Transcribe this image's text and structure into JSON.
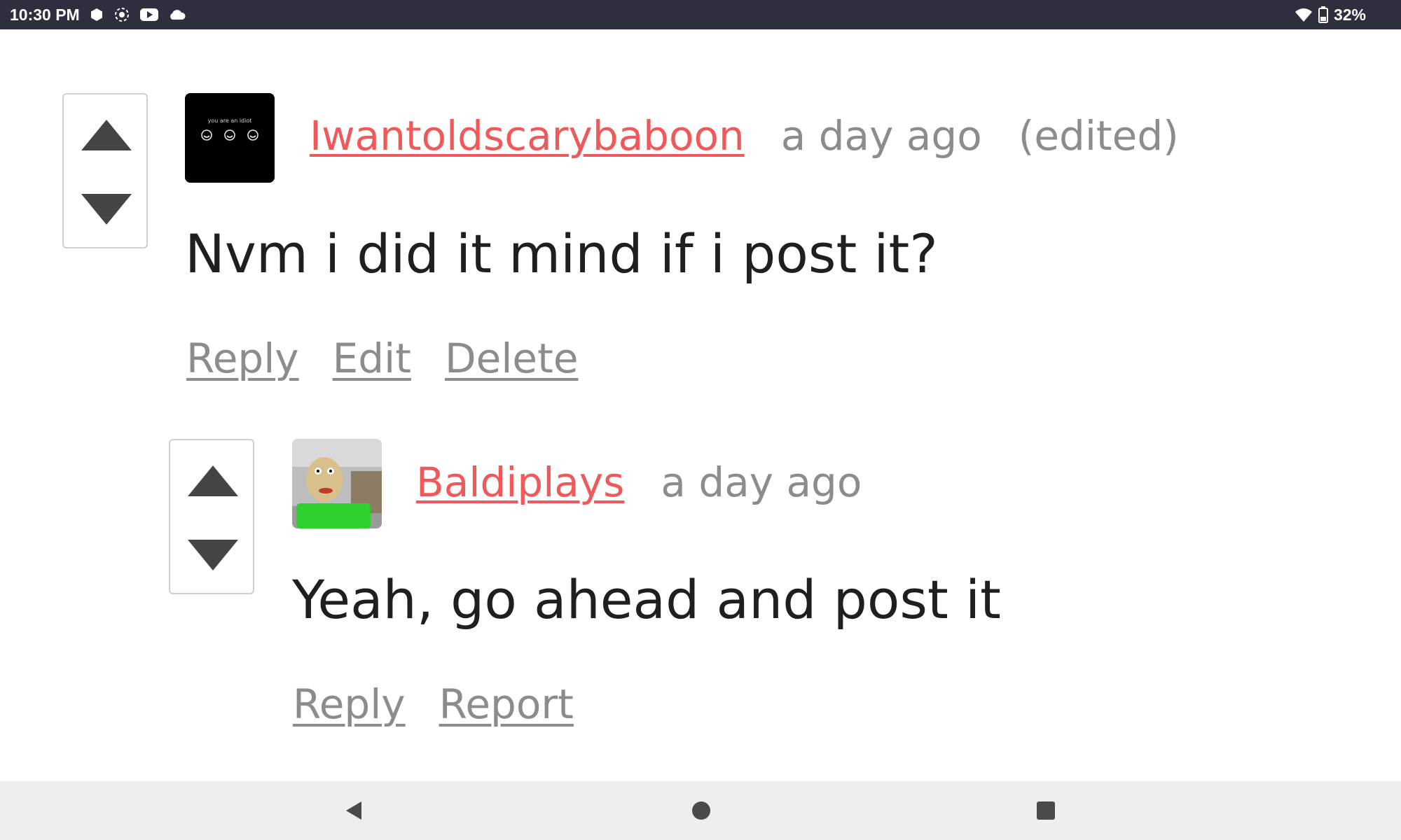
{
  "status_bar": {
    "time": "10:30 PM",
    "battery": "32%",
    "icons": [
      "hexagon-icon",
      "record-icon",
      "youtube-icon",
      "cloud-icon",
      "wifi-icon",
      "battery-icon"
    ]
  },
  "comments": [
    {
      "username": "Iwantoldscarybaboon",
      "time_ago": "a day ago",
      "edited": "(edited)",
      "body": "Nvm i did it mind if i post it?",
      "avatar": {
        "caption": "you are an idiot",
        "icon": "smiley-faces-icon"
      },
      "actions": [
        "Reply",
        "Edit",
        "Delete"
      ]
    },
    {
      "username": "Baldiplays",
      "time_ago": "a day ago",
      "body": "Yeah, go ahead and post it",
      "avatar": {
        "icon": "baldi-character-icon"
      },
      "actions": [
        "Reply",
        "Report"
      ]
    }
  ],
  "colors": {
    "username": "#f0595a",
    "meta": "#8c8c8c",
    "body": "#1f1f1f",
    "status_bar": "#2e2f3e",
    "nav_bar": "#eeeeee"
  },
  "nav_bar": {
    "icons": [
      "back-icon",
      "home-icon",
      "recents-icon"
    ]
  }
}
